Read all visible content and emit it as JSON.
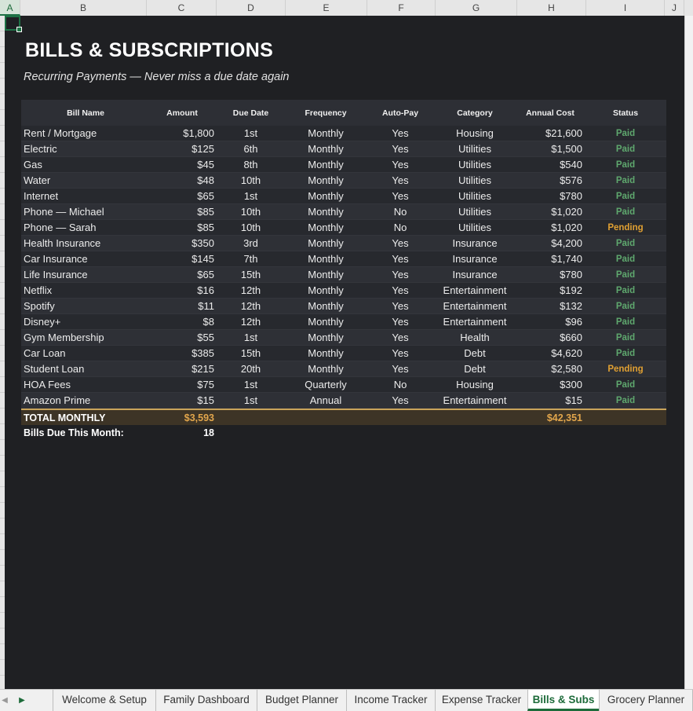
{
  "columns": [
    "A",
    "B",
    "C",
    "D",
    "E",
    "F",
    "G",
    "H",
    "I",
    "J"
  ],
  "sheet": {
    "title": "BILLS & SUBSCRIPTIONS",
    "subtitle": "Recurring Payments — Never miss a due date again"
  },
  "table": {
    "headers": {
      "name": "Bill Name",
      "amount": "Amount",
      "due": "Due Date",
      "frequency": "Frequency",
      "autopay": "Auto-Pay",
      "category": "Category",
      "annual": "Annual Cost",
      "status": "Status"
    },
    "rows": [
      {
        "name": "Rent / Mortgage",
        "amount": "$1,800",
        "due": "1st",
        "frequency": "Monthly",
        "autopay": "Yes",
        "category": "Housing",
        "annual": "$21,600",
        "status": "Paid"
      },
      {
        "name": "Electric",
        "amount": "$125",
        "due": "6th",
        "frequency": "Monthly",
        "autopay": "Yes",
        "category": "Utilities",
        "annual": "$1,500",
        "status": "Paid"
      },
      {
        "name": "Gas",
        "amount": "$45",
        "due": "8th",
        "frequency": "Monthly",
        "autopay": "Yes",
        "category": "Utilities",
        "annual": "$540",
        "status": "Paid"
      },
      {
        "name": "Water",
        "amount": "$48",
        "due": "10th",
        "frequency": "Monthly",
        "autopay": "Yes",
        "category": "Utilities",
        "annual": "$576",
        "status": "Paid"
      },
      {
        "name": "Internet",
        "amount": "$65",
        "due": "1st",
        "frequency": "Monthly",
        "autopay": "Yes",
        "category": "Utilities",
        "annual": "$780",
        "status": "Paid"
      },
      {
        "name": "Phone — Michael",
        "amount": "$85",
        "due": "10th",
        "frequency": "Monthly",
        "autopay": "No",
        "category": "Utilities",
        "annual": "$1,020",
        "status": "Paid"
      },
      {
        "name": "Phone — Sarah",
        "amount": "$85",
        "due": "10th",
        "frequency": "Monthly",
        "autopay": "No",
        "category": "Utilities",
        "annual": "$1,020",
        "status": "Pending"
      },
      {
        "name": "Health Insurance",
        "amount": "$350",
        "due": "3rd",
        "frequency": "Monthly",
        "autopay": "Yes",
        "category": "Insurance",
        "annual": "$4,200",
        "status": "Paid"
      },
      {
        "name": "Car Insurance",
        "amount": "$145",
        "due": "7th",
        "frequency": "Monthly",
        "autopay": "Yes",
        "category": "Insurance",
        "annual": "$1,740",
        "status": "Paid"
      },
      {
        "name": "Life Insurance",
        "amount": "$65",
        "due": "15th",
        "frequency": "Monthly",
        "autopay": "Yes",
        "category": "Insurance",
        "annual": "$780",
        "status": "Paid"
      },
      {
        "name": "Netflix",
        "amount": "$16",
        "due": "12th",
        "frequency": "Monthly",
        "autopay": "Yes",
        "category": "Entertainment",
        "annual": "$192",
        "status": "Paid"
      },
      {
        "name": "Spotify",
        "amount": "$11",
        "due": "12th",
        "frequency": "Monthly",
        "autopay": "Yes",
        "category": "Entertainment",
        "annual": "$132",
        "status": "Paid"
      },
      {
        "name": "Disney+",
        "amount": "$8",
        "due": "12th",
        "frequency": "Monthly",
        "autopay": "Yes",
        "category": "Entertainment",
        "annual": "$96",
        "status": "Paid"
      },
      {
        "name": "Gym Membership",
        "amount": "$55",
        "due": "1st",
        "frequency": "Monthly",
        "autopay": "Yes",
        "category": "Health",
        "annual": "$660",
        "status": "Paid"
      },
      {
        "name": "Car Loan",
        "amount": "$385",
        "due": "15th",
        "frequency": "Monthly",
        "autopay": "Yes",
        "category": "Debt",
        "annual": "$4,620",
        "status": "Paid"
      },
      {
        "name": "Student Loan",
        "amount": "$215",
        "due": "20th",
        "frequency": "Monthly",
        "autopay": "Yes",
        "category": "Debt",
        "annual": "$2,580",
        "status": "Pending"
      },
      {
        "name": "HOA Fees",
        "amount": "$75",
        "due": "1st",
        "frequency": "Quarterly",
        "autopay": "No",
        "category": "Housing",
        "annual": "$300",
        "status": "Paid"
      },
      {
        "name": "Amazon Prime",
        "amount": "$15",
        "due": "1st",
        "frequency": "Annual",
        "autopay": "Yes",
        "category": "Entertainment",
        "annual": "$15",
        "status": "Paid"
      }
    ],
    "total": {
      "label": "TOTAL MONTHLY",
      "amount": "$3,593",
      "annual": "$42,351"
    },
    "due_count": {
      "label": "Bills Due This Month:",
      "value": "18"
    }
  },
  "status_colors": {
    "Paid": "#5fa86e",
    "Pending": "#e0a032"
  },
  "tabs": {
    "nav_icon": "next-sheet-icon",
    "items": [
      "Welcome & Setup",
      "Family Dashboard",
      "Budget Planner",
      "Income Tracker",
      "Expense Tracker",
      "Bills & Subs",
      "Grocery Planner"
    ],
    "active": "Bills & Subs"
  }
}
